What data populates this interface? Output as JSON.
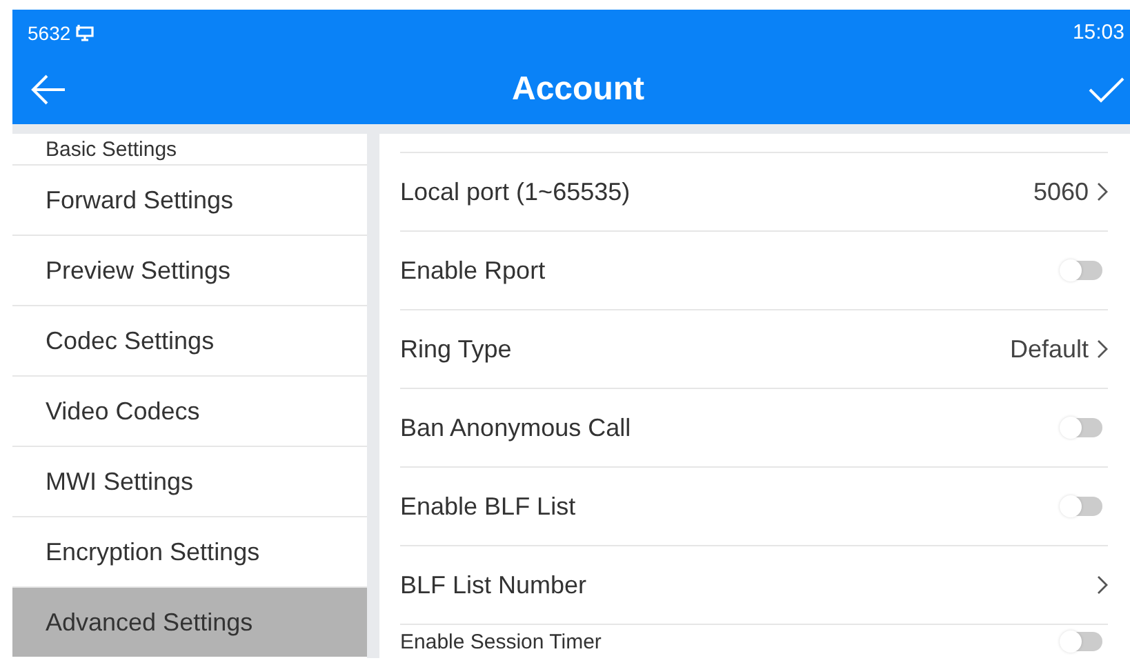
{
  "status_bar": {
    "extension": "5632",
    "time": "15:03"
  },
  "header": {
    "title": "Account"
  },
  "sidebar": {
    "items": [
      {
        "label": "Basic Settings",
        "selected": false
      },
      {
        "label": "Forward Settings",
        "selected": false
      },
      {
        "label": "Preview Settings",
        "selected": false
      },
      {
        "label": "Codec Settings",
        "selected": false
      },
      {
        "label": "Video Codecs",
        "selected": false
      },
      {
        "label": "MWI Settings",
        "selected": false
      },
      {
        "label": "Encryption Settings",
        "selected": false
      },
      {
        "label": "Advanced Settings",
        "selected": true
      }
    ]
  },
  "settings": [
    {
      "kind": "link",
      "label": "Local port (1~65535)",
      "value": "5060"
    },
    {
      "kind": "toggle",
      "label": "Enable Rport",
      "on": false
    },
    {
      "kind": "link",
      "label": "Ring Type",
      "value": "Default"
    },
    {
      "kind": "toggle",
      "label": "Ban Anonymous Call",
      "on": false
    },
    {
      "kind": "toggle",
      "label": "Enable BLF List",
      "on": false
    },
    {
      "kind": "link",
      "label": "BLF List Number"
    },
    {
      "kind": "toggle",
      "label": "Enable Session Timer",
      "on": false
    }
  ]
}
